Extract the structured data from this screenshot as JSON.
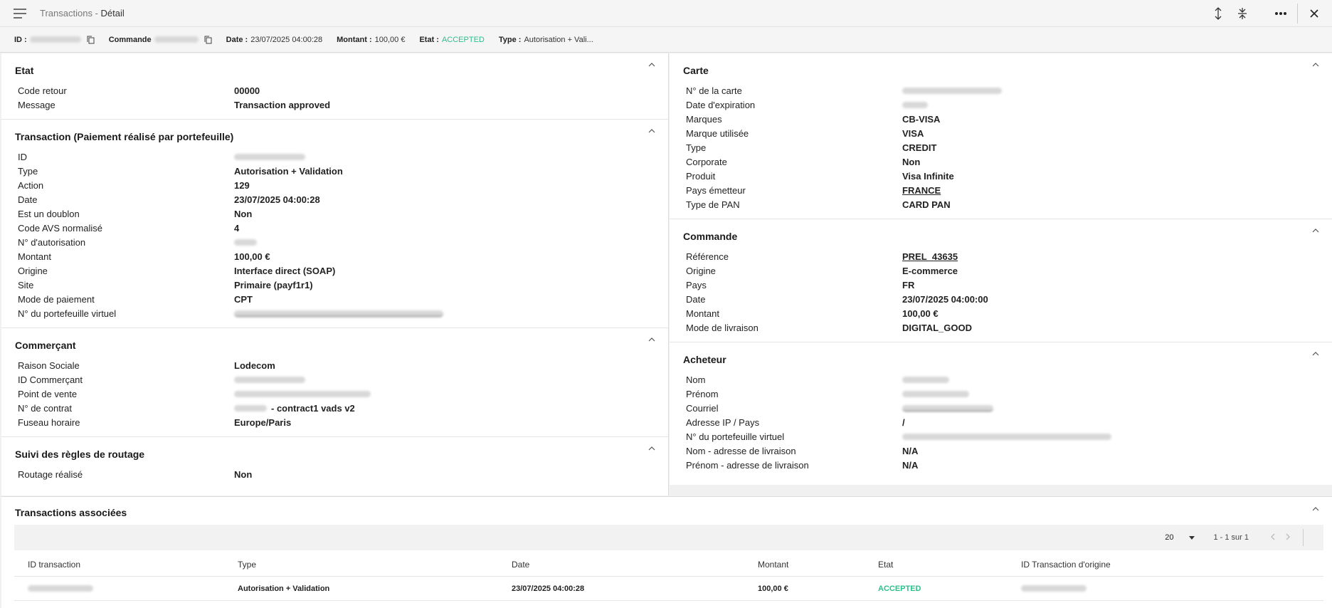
{
  "header": {
    "title_prefix": "Transactions",
    "title_separator": " - ",
    "title_page": "Détail"
  },
  "summary": {
    "id_label": "ID :",
    "commande_label": "Commande",
    "date_label": "Date :",
    "date_value": "23/07/2025 04:00:28",
    "montant_label": "Montant :",
    "montant_value": "100,00 €",
    "etat_label": "Etat :",
    "etat_value": "ACCEPTED",
    "type_label": "Type :",
    "type_value": "Autorisation + Vali..."
  },
  "etat": {
    "title": "Etat",
    "rows": [
      {
        "label": "Code retour",
        "value": "00000"
      },
      {
        "label": "Message",
        "value": "Transaction approved"
      }
    ]
  },
  "transaction": {
    "title": "Transaction (Paiement réalisé par portefeuille)",
    "rows": [
      {
        "label": "ID",
        "value": ""
      },
      {
        "label": "Type",
        "value": "Autorisation + Validation"
      },
      {
        "label": "Action",
        "value": "129"
      },
      {
        "label": "Date",
        "value": "23/07/2025 04:00:28"
      },
      {
        "label": "Est un doublon",
        "value": "Non"
      },
      {
        "label": "Code AVS normalisé",
        "value": "4"
      },
      {
        "label": "N° d'autorisation",
        "value": ""
      },
      {
        "label": "Montant",
        "value": "100,00 €"
      },
      {
        "label": "Origine",
        "value": "Interface direct (SOAP)"
      },
      {
        "label": "Site",
        "value": "Primaire (payf1r1)"
      },
      {
        "label": "Mode de paiement",
        "value": "CPT"
      },
      {
        "label": "N° du portefeuille virtuel",
        "value": ""
      }
    ]
  },
  "commercant": {
    "title": "Commerçant",
    "rows": [
      {
        "label": "Raison Sociale",
        "value": "Lodecom"
      },
      {
        "label": "ID Commerçant",
        "value": ""
      },
      {
        "label": "Point de vente",
        "value": ""
      },
      {
        "label": "N° de contrat",
        "value": "- contract1 vads v2"
      },
      {
        "label": "Fuseau horaire",
        "value": "Europe/Paris"
      }
    ]
  },
  "routage": {
    "title": "Suivi des règles de routage",
    "rows": [
      {
        "label": "Routage réalisé",
        "value": "Non"
      }
    ]
  },
  "carte": {
    "title": "Carte",
    "rows": [
      {
        "label": "N° de la carte",
        "value": ""
      },
      {
        "label": "Date d'expiration",
        "value": ""
      },
      {
        "label": "Marques",
        "value": "CB-VISA"
      },
      {
        "label": "Marque utilisée",
        "value": "VISA"
      },
      {
        "label": "Type",
        "value": "CREDIT"
      },
      {
        "label": "Corporate",
        "value": "Non"
      },
      {
        "label": "Produit",
        "value": "Visa Infinite"
      },
      {
        "label": "Pays émetteur",
        "value": "FRANCE"
      },
      {
        "label": "Type de PAN",
        "value": "CARD PAN"
      }
    ]
  },
  "commande": {
    "title": "Commande",
    "rows": [
      {
        "label": "Référence",
        "value": "PREL_43635"
      },
      {
        "label": "Origine",
        "value": "E-commerce"
      },
      {
        "label": "Pays",
        "value": "FR"
      },
      {
        "label": "Date",
        "value": "23/07/2025 04:00:00"
      },
      {
        "label": "Montant",
        "value": "100,00 €"
      },
      {
        "label": "Mode de livraison",
        "value": "DIGITAL_GOOD"
      }
    ]
  },
  "acheteur": {
    "title": "Acheteur",
    "rows": [
      {
        "label": "Nom",
        "value": ""
      },
      {
        "label": "Prénom",
        "value": ""
      },
      {
        "label": "Courriel",
        "value": ""
      },
      {
        "label": "Adresse IP / Pays",
        "value": "/"
      },
      {
        "label": "N° du portefeuille virtuel",
        "value": ""
      },
      {
        "label": "Nom - adresse de livraison",
        "value": "N/A"
      },
      {
        "label": "Prénom - adresse de livraison",
        "value": "N/A"
      }
    ]
  },
  "associees": {
    "title": "Transactions associées",
    "page_size": "20",
    "page_count": "1 - 1 sur 1",
    "columns": [
      "ID transaction",
      "Type",
      "Date",
      "Montant",
      "Etat",
      "ID Transaction d'origine"
    ],
    "rows": [
      {
        "id": "",
        "type": "Autorisation + Validation",
        "date": "23/07/2025 04:00:28",
        "montant": "100,00 €",
        "etat": "ACCEPTED",
        "origine": ""
      }
    ]
  },
  "colors": {
    "accepted": "#2bbf8a",
    "background": "#f0f0f0",
    "panel": "#ffffff"
  }
}
